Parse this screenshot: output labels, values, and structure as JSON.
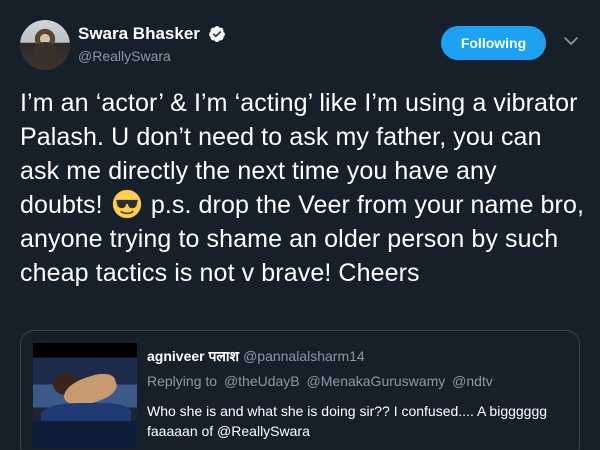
{
  "tweet": {
    "author": {
      "display_name": "Swara Bhasker",
      "handle": "@ReallySwara",
      "verified": true
    },
    "follow_label": "Following",
    "text_parts": {
      "before_emoji": "I’m an ‘actor’ & I’m ‘acting’ like I’m using a vibrator Palash. U don’t need to ask my father, you can ask me directly the next time you have any doubts!",
      "after_emoji": "p.s. drop the Veer from your name bro, anyone trying to shame an older person by such cheap tactics is not v brave! Cheers"
    },
    "emoji": "smiling-face-with-sunglasses",
    "quoted": {
      "author_name": "agniveer पलाश",
      "author_handle": "@pannalalsharm14",
      "replying_to_label": "Replying to",
      "replying_to": [
        "@theUdayB",
        "@MenakaGuruswamy",
        "@ndtv"
      ],
      "text": "Who she is and what she is doing sir?? I confused.... A bigggggg faaaaan of @ReallySwara"
    }
  },
  "colors": {
    "background": "#15202b",
    "accent": "#1da1f2",
    "secondary_text": "#8899a6",
    "border": "#38444d"
  }
}
